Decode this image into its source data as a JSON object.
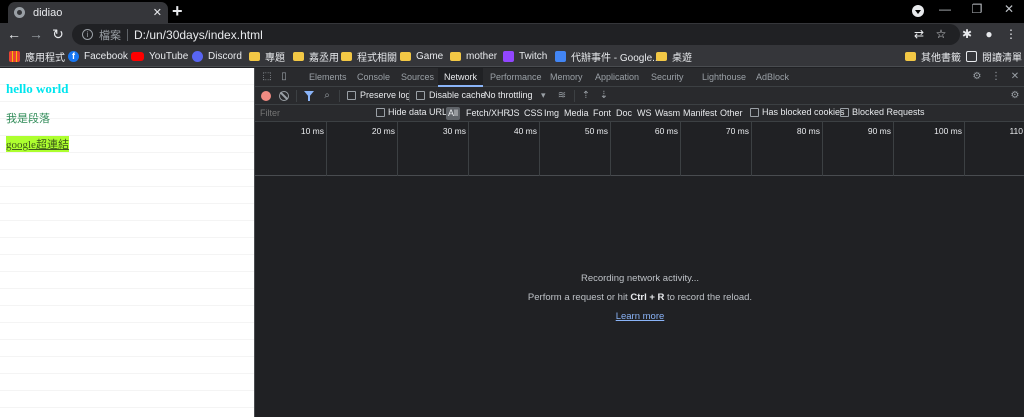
{
  "browser": {
    "tab_title": "didiao",
    "new_tab_symbol": "+",
    "address": {
      "security_label": "檔案",
      "url": "D:/un/30days/index.html"
    }
  },
  "bookmarks": [
    {
      "label": "應用程式",
      "icon": "apps-grid-icon"
    },
    {
      "label": "Facebook",
      "icon": "facebook-icon"
    },
    {
      "label": "YouTube",
      "icon": "youtube-icon"
    },
    {
      "label": "Discord",
      "icon": "discord-icon"
    },
    {
      "label": "專題",
      "icon": "folder-icon"
    },
    {
      "label": "嘉丞用",
      "icon": "folder-icon"
    },
    {
      "label": "程式相關",
      "icon": "folder-icon"
    },
    {
      "label": "Game",
      "icon": "folder-icon"
    },
    {
      "label": "mother",
      "icon": "folder-icon"
    },
    {
      "label": "Twitch",
      "icon": "twitch-icon"
    },
    {
      "label": "代辦事件 - Google...",
      "icon": "google-docs-icon"
    },
    {
      "label": "桌遊",
      "icon": "folder-icon"
    }
  ],
  "bookmarks_right": [
    {
      "label": "其他書籤",
      "icon": "folder-icon"
    },
    {
      "label": "閱讀清單",
      "icon": "reading-list-icon"
    }
  ],
  "page": {
    "heading": "hello world",
    "paragraph": "我是段落",
    "link": "google超連結"
  },
  "devtools": {
    "tabs": [
      "Elements",
      "Console",
      "Sources",
      "Network",
      "Performance",
      "Memory",
      "Application",
      "Security",
      "Lighthouse",
      "AdBlock"
    ],
    "active_tab": "Network",
    "toolbar": {
      "preserve_log": "Preserve log",
      "disable_cache": "Disable cache",
      "throttling": "No throttling"
    },
    "filter": {
      "placeholder": "Filter",
      "hide_data_urls": "Hide data URLs",
      "types": [
        "All",
        "Fetch/XHR",
        "JS",
        "CSS",
        "Img",
        "Media",
        "Font",
        "Doc",
        "WS",
        "Wasm",
        "Manifest",
        "Other"
      ],
      "has_blocked_cookies": "Has blocked cookies",
      "blocked_requests": "Blocked Requests"
    },
    "timeline_ticks": [
      "10 ms",
      "20 ms",
      "30 ms",
      "40 ms",
      "50 ms",
      "60 ms",
      "70 ms",
      "80 ms",
      "90 ms",
      "100 ms",
      "110"
    ],
    "empty_state": {
      "line1": "Recording network activity...",
      "line2_prefix": "Perform a request or hit ",
      "line2_key": "Ctrl + R",
      "line2_suffix": " to record the reload.",
      "learn_more": "Learn more"
    }
  },
  "colors": {
    "heading": "#00e5ee",
    "paragraph": "#2e8b57",
    "link_bg": "#adff2f",
    "devtools_bg": "#202124",
    "accent": "#8ab4f8"
  }
}
